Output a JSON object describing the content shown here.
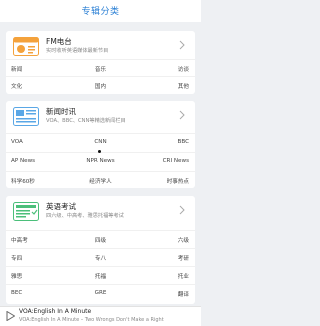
{
  "header": {
    "title": "专辑分类"
  },
  "categories": [
    {
      "title": "FM电台",
      "desc": "实时收听英语媒体最新节目",
      "icon": "radio-icon",
      "items": [
        [
          "新闻",
          "音乐",
          "访谈"
        ],
        [
          "文化",
          "国内",
          "其他"
        ]
      ]
    },
    {
      "title": "新闻时讯",
      "desc": "VOA、BBC、CNN等精选新闻栏目",
      "icon": "news-icon",
      "items": [
        [
          "VOA",
          "CNN",
          "BBC"
        ],
        [
          "AP News",
          "NPR News",
          "CRI News"
        ],
        [
          "科学60秒",
          "经济学人",
          "时事热点"
        ]
      ]
    },
    {
      "title": "英语考试",
      "desc": "四六级、中高考、雅思托福等考试",
      "icon": "exam-icon",
      "items": [
        [
          "中高考",
          "四级",
          "六级"
        ],
        [
          "专四",
          "专八",
          "考研"
        ],
        [
          "雅思",
          "托福",
          "托业"
        ],
        [
          "BEC",
          "GRE",
          "翻译"
        ]
      ]
    }
  ],
  "player": {
    "title": "VOA:English In A Minute",
    "subtitle": "VOA:English In A Minute – Two Wrongs Don't Make a Right"
  },
  "colors": {
    "accent": "#2a7fd4",
    "icon_orange": "#f4a23c",
    "icon_blue": "#5aa7e6",
    "icon_green": "#4bbf7a"
  }
}
